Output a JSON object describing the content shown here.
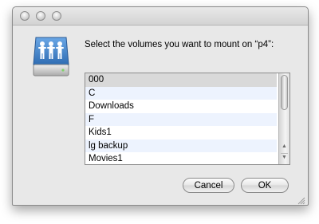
{
  "dialog": {
    "prompt": "Select the volumes you want to mount on “p4”:",
    "icon": "network-server-drive-icon"
  },
  "volumes": {
    "items": [
      {
        "label": "000",
        "selected": true
      },
      {
        "label": "C",
        "selected": false
      },
      {
        "label": "Downloads",
        "selected": false
      },
      {
        "label": "F",
        "selected": false
      },
      {
        "label": "Kids1",
        "selected": false
      },
      {
        "label": "lg backup",
        "selected": false
      },
      {
        "label": "Movies1",
        "selected": false
      }
    ]
  },
  "buttons": {
    "cancel_label": "Cancel",
    "ok_label": "OK"
  },
  "colors": {
    "window_bg": "#e8e8e8",
    "alt_row": "#edf3fe",
    "selected_row": "#d9d9d9",
    "drive_accent": "#3f82c8"
  }
}
